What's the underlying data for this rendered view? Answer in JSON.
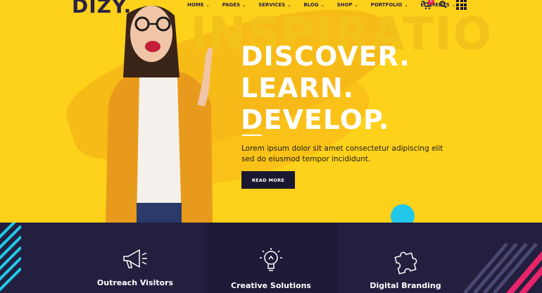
{
  "brand": {
    "name": "DIZY",
    "dot": "."
  },
  "nav": {
    "items": [
      {
        "label": "HOME"
      },
      {
        "label": "PAGES"
      },
      {
        "label": "SERVICES"
      },
      {
        "label": "BLOG"
      },
      {
        "label": "SHOP"
      },
      {
        "label": "PORTFOLIO"
      },
      {
        "label": "ELEMENTS"
      }
    ],
    "cart_count": "0"
  },
  "hero": {
    "watermark": "INSPIRATIO",
    "headline_1": "DISCOVER.",
    "headline_2": "LEARN.",
    "headline_3": "DEVELOP.",
    "description": "Lorem ipsum dolor sit amet consectetur adipiscing elit sed do eiusmod tempor incididunt.",
    "button_label": "READ MORE"
  },
  "features": [
    {
      "label": "Outreach Visitors",
      "icon": "megaphone-icon"
    },
    {
      "label": "Creative Solutions",
      "icon": "lightbulb-icon"
    },
    {
      "label": "Digital Branding",
      "icon": "puzzle-icon"
    }
  ],
  "colors": {
    "hero_bg": "#fed11a",
    "dark_band": "#231f3e",
    "accent_cyan": "#21c8e8",
    "accent_pink": "#e8244e"
  }
}
